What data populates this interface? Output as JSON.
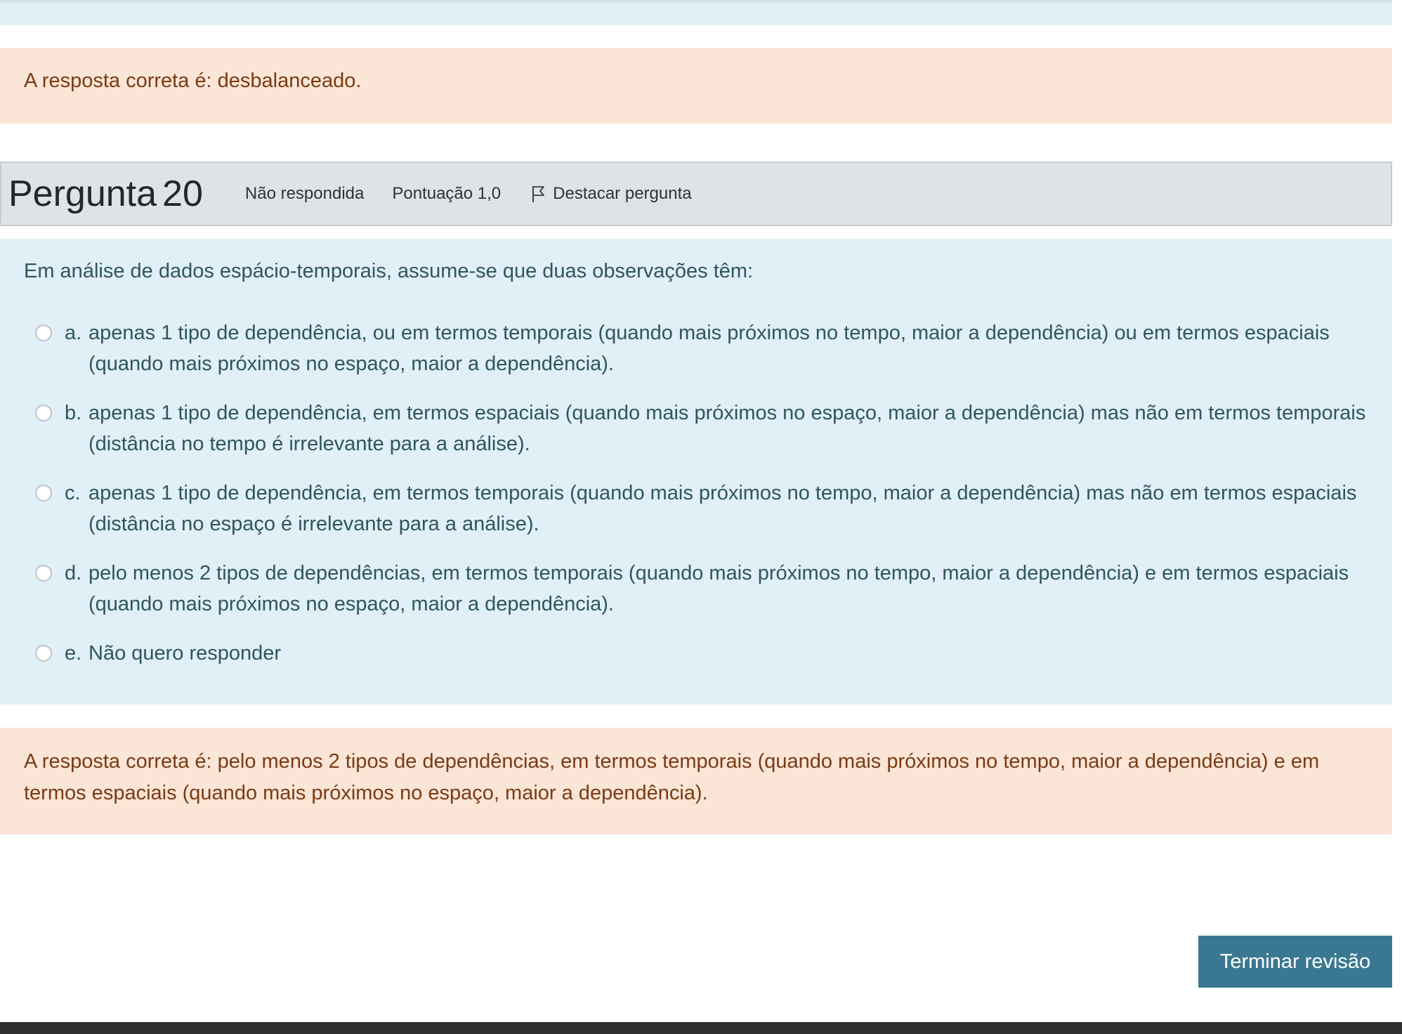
{
  "feedback_top": {
    "text": "A resposta correta é: desbalanceado."
  },
  "question": {
    "label": "Pergunta",
    "number": "20",
    "status": "Não respondida",
    "score": "Pontuação 1,0",
    "flag_label": "Destacar pergunta",
    "flag_icon": "flag-icon",
    "text": "Em análise de dados espácio-temporais, assume-se que duas observações têm:",
    "answers": [
      {
        "letter": "a.",
        "text": "apenas 1 tipo de dependência, ou em termos temporais (quando mais próximos no tempo, maior a dependência) ou em termos espaciais (quando mais próximos no espaço, maior a dependência)."
      },
      {
        "letter": "b.",
        "text": "apenas 1 tipo de dependência, em termos espaciais (quando mais próximos no espaço, maior a dependência) mas não em termos temporais (distância no tempo é irrelevante para a análise)."
      },
      {
        "letter": "c.",
        "text": "apenas 1 tipo de dependência, em termos temporais (quando mais próximos no tempo, maior a dependência) mas não em termos espaciais (distância no espaço é irrelevante para a análise)."
      },
      {
        "letter": "d.",
        "text": "pelo menos 2 tipos de dependências, em termos temporais (quando mais próximos no tempo, maior a dependência) e em termos espaciais (quando mais próximos no espaço, maior a dependência)."
      },
      {
        "letter": "e.",
        "text": "Não quero responder"
      }
    ]
  },
  "feedback_bottom": {
    "text": "A resposta correta é: pelo menos 2 tipos de dependências, em termos temporais (quando mais próximos no tempo, maior a dependência) e em termos espaciais (quando mais próximos no espaço, maior a dependência)."
  },
  "actions": {
    "finish_label": "Terminar revisão"
  },
  "colors": {
    "info_bg": "#e1eff6",
    "feedback_bg": "#fae5d7",
    "feedback_text": "#7c3a12",
    "header_bg": "#dfe2e6",
    "button_bg": "#3a7891"
  }
}
